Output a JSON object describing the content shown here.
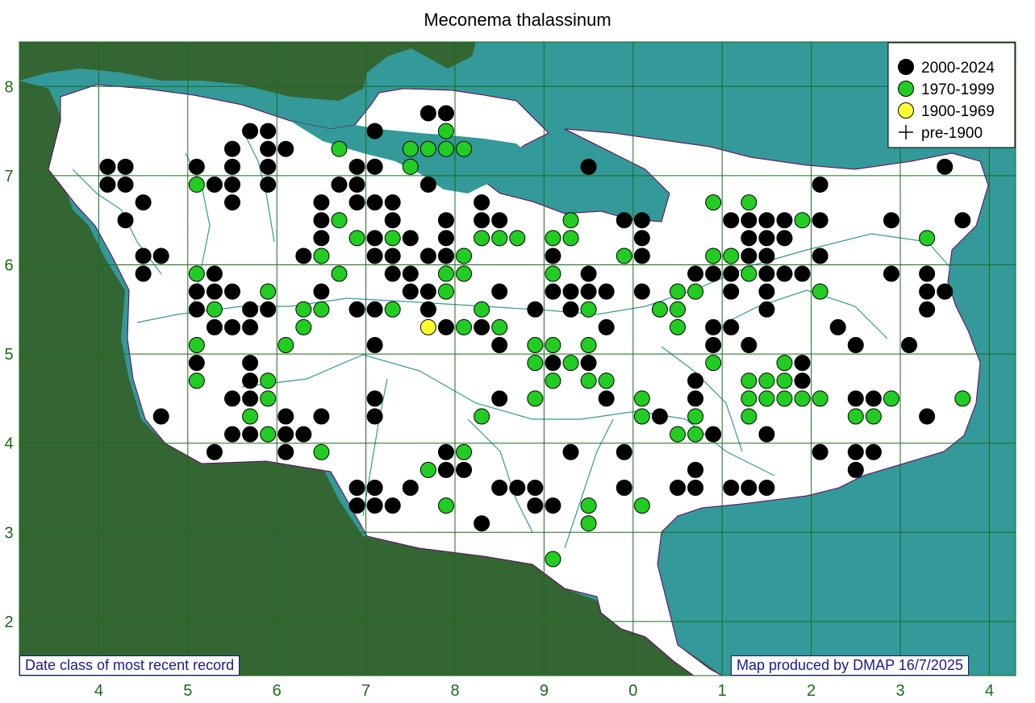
{
  "title": "Meconema thalassinum",
  "legend": [
    {
      "label": "2000-2024",
      "marker": "circle",
      "color": "#000000"
    },
    {
      "label": "1970-1999",
      "marker": "circle",
      "color": "#22cc22"
    },
    {
      "label": "1900-1969",
      "marker": "circle",
      "color": "#ffff33"
    },
    {
      "label": "pre-1900",
      "marker": "cross",
      "color": "#000000"
    }
  ],
  "x_axis_labels": [
    "4",
    "5",
    "6",
    "7",
    "8",
    "9",
    "0",
    "1",
    "2",
    "3",
    "4"
  ],
  "y_axis_labels": [
    "8",
    "7",
    "6",
    "5",
    "4",
    "3",
    "2"
  ],
  "notes": {
    "left": "Date class of most recent record",
    "right": "Map produced by DMAP 16/7/2025"
  },
  "colors": {
    "land_outside": "#336633",
    "sea": "#339999",
    "county": "#ffffff",
    "grid": "#1a6b1a",
    "river": "#339999",
    "boundary": "#660066"
  },
  "chart_data": {
    "type": "scatter",
    "title": "Meconema thalassinum",
    "series": [
      {
        "name": "2000-2024",
        "points": [
          [
            4.1,
            7.1
          ],
          [
            4.3,
            7.1
          ],
          [
            4.1,
            6.9
          ],
          [
            4.3,
            6.9
          ],
          [
            4.5,
            6.7
          ],
          [
            4.3,
            6.5
          ],
          [
            4.5,
            6.1
          ],
          [
            4.7,
            6.1
          ],
          [
            4.5,
            5.9
          ],
          [
            4.7,
            4.3
          ],
          [
            5.1,
            7.1
          ],
          [
            5.3,
            6.9
          ],
          [
            5.5,
            6.9
          ],
          [
            5.5,
            7.1
          ],
          [
            5.5,
            7.3
          ],
          [
            5.7,
            7.5
          ],
          [
            5.9,
            7.5
          ],
          [
            5.9,
            7.3
          ],
          [
            6.1,
            7.3
          ],
          [
            5.9,
            7.1
          ],
          [
            5.9,
            6.9
          ],
          [
            5.5,
            6.7
          ],
          [
            5.3,
            5.9
          ],
          [
            5.1,
            5.7
          ],
          [
            5.3,
            5.7
          ],
          [
            5.5,
            5.7
          ],
          [
            5.1,
            5.5
          ],
          [
            5.3,
            5.3
          ],
          [
            5.5,
            5.3
          ],
          [
            5.7,
            5.3
          ],
          [
            5.7,
            5.5
          ],
          [
            5.9,
            5.5
          ],
          [
            5.1,
            4.9
          ],
          [
            5.7,
            4.9
          ],
          [
            5.7,
            4.7
          ],
          [
            5.5,
            4.5
          ],
          [
            5.7,
            4.5
          ],
          [
            5.5,
            4.1
          ],
          [
            5.7,
            4.1
          ],
          [
            6.1,
            4.3
          ],
          [
            6.1,
            4.1
          ],
          [
            6.3,
            4.1
          ],
          [
            6.1,
            3.9
          ],
          [
            5.3,
            3.9
          ],
          [
            6.5,
            6.7
          ],
          [
            6.5,
            6.5
          ],
          [
            6.5,
            6.3
          ],
          [
            6.3,
            6.1
          ],
          [
            6.5,
            5.7
          ],
          [
            6.5,
            4.3
          ],
          [
            6.7,
            6.9
          ],
          [
            6.9,
            6.9
          ],
          [
            6.9,
            7.1
          ],
          [
            7.1,
            7.1
          ],
          [
            7.1,
            7.5
          ],
          [
            6.9,
            6.7
          ],
          [
            7.1,
            6.7
          ],
          [
            7.3,
            6.7
          ],
          [
            7.3,
            6.5
          ],
          [
            7.1,
            6.3
          ],
          [
            7.1,
            6.1
          ],
          [
            7.3,
            6.1
          ],
          [
            7.3,
            5.9
          ],
          [
            7.5,
            6.3
          ],
          [
            7.5,
            5.9
          ],
          [
            7.5,
            5.7
          ],
          [
            6.9,
            5.5
          ],
          [
            7.1,
            5.5
          ],
          [
            7.1,
            5.1
          ],
          [
            7.1,
            4.5
          ],
          [
            7.1,
            4.3
          ],
          [
            6.9,
            3.5
          ],
          [
            7.1,
            3.5
          ],
          [
            6.9,
            3.3
          ],
          [
            7.1,
            3.3
          ],
          [
            7.3,
            3.3
          ],
          [
            7.5,
            3.5
          ],
          [
            7.7,
            7.7
          ],
          [
            7.9,
            7.7
          ],
          [
            7.7,
            6.9
          ],
          [
            7.7,
            6.1
          ],
          [
            7.9,
            6.5
          ],
          [
            7.9,
            6.3
          ],
          [
            7.9,
            6.1
          ],
          [
            7.7,
            5.7
          ],
          [
            7.7,
            5.5
          ],
          [
            7.9,
            5.3
          ],
          [
            8.3,
            5.3
          ],
          [
            8.3,
            6.7
          ],
          [
            8.3,
            6.5
          ],
          [
            8.5,
            6.5
          ],
          [
            8.5,
            5.7
          ],
          [
            8.5,
            5.1
          ],
          [
            8.5,
            4.5
          ],
          [
            7.9,
            3.9
          ],
          [
            7.9,
            3.7
          ],
          [
            8.1,
            3.7
          ],
          [
            8.5,
            3.5
          ],
          [
            8.7,
            3.5
          ],
          [
            8.9,
            3.5
          ],
          [
            8.9,
            3.3
          ],
          [
            9.1,
            3.3
          ],
          [
            8.3,
            3.1
          ],
          [
            9.1,
            6.1
          ],
          [
            9.1,
            5.7
          ],
          [
            9.3,
            5.7
          ],
          [
            8.9,
            5.5
          ],
          [
            9.3,
            5.5
          ],
          [
            9.1,
            4.9
          ],
          [
            9.5,
            4.9
          ],
          [
            9.5,
            5.9
          ],
          [
            9.5,
            5.7
          ],
          [
            9.7,
            5.7
          ],
          [
            9.7,
            5.3
          ],
          [
            9.7,
            4.5
          ],
          [
            9.5,
            7.1
          ],
          [
            9.9,
            6.5
          ],
          [
            10.1,
            6.5
          ],
          [
            10.1,
            6.3
          ],
          [
            10.1,
            6.1
          ],
          [
            10.1,
            5.7
          ],
          [
            9.3,
            3.9
          ],
          [
            9.9,
            3.9
          ],
          [
            9.9,
            3.5
          ],
          [
            10.3,
            4.3
          ],
          [
            10.5,
            3.5
          ],
          [
            10.7,
            3.5
          ],
          [
            10.7,
            3.7
          ],
          [
            10.7,
            4.7
          ],
          [
            10.7,
            4.5
          ],
          [
            10.7,
            5.9
          ],
          [
            10.9,
            5.9
          ],
          [
            10.9,
            5.3
          ],
          [
            10.9,
            5.1
          ],
          [
            10.9,
            4.1
          ],
          [
            11.1,
            5.9
          ],
          [
            11.1,
            5.7
          ],
          [
            11.1,
            5.3
          ],
          [
            11.3,
            5.1
          ],
          [
            11.1,
            3.5
          ],
          [
            11.3,
            3.5
          ],
          [
            11.5,
            3.5
          ],
          [
            11.5,
            4.1
          ],
          [
            11.1,
            6.5
          ],
          [
            11.3,
            6.5
          ],
          [
            11.5,
            6.5
          ],
          [
            11.7,
            6.5
          ],
          [
            11.3,
            6.3
          ],
          [
            11.5,
            6.3
          ],
          [
            11.7,
            6.3
          ],
          [
            11.3,
            6.1
          ],
          [
            11.5,
            6.1
          ],
          [
            11.5,
            5.9
          ],
          [
            11.7,
            5.9
          ],
          [
            11.9,
            5.9
          ],
          [
            11.5,
            5.7
          ],
          [
            11.5,
            5.5
          ],
          [
            11.9,
            4.9
          ],
          [
            11.9,
            4.7
          ],
          [
            12.1,
            6.9
          ],
          [
            12.1,
            6.5
          ],
          [
            12.1,
            6.1
          ],
          [
            12.1,
            3.9
          ],
          [
            12.3,
            5.3
          ],
          [
            12.5,
            5.1
          ],
          [
            12.5,
            4.5
          ],
          [
            12.7,
            4.5
          ],
          [
            12.5,
            3.9
          ],
          [
            12.7,
            3.9
          ],
          [
            12.5,
            3.7
          ],
          [
            12.9,
            6.5
          ],
          [
            12.9,
            5.9
          ],
          [
            13.1,
            5.1
          ],
          [
            13.3,
            5.9
          ],
          [
            13.3,
            5.7
          ],
          [
            13.5,
            5.7
          ],
          [
            13.3,
            5.5
          ],
          [
            13.3,
            4.3
          ],
          [
            13.5,
            7.1
          ],
          [
            13.7,
            6.5
          ]
        ]
      },
      {
        "name": "1970-1999",
        "points": [
          [
            5.1,
            6.9
          ],
          [
            5.1,
            5.1
          ],
          [
            5.1,
            4.7
          ],
          [
            5.1,
            5.9
          ],
          [
            5.3,
            5.5
          ],
          [
            5.9,
            5.7
          ],
          [
            6.1,
            5.1
          ],
          [
            5.9,
            4.7
          ],
          [
            5.9,
            4.5
          ],
          [
            5.7,
            4.3
          ],
          [
            5.9,
            4.1
          ],
          [
            6.3,
            5.5
          ],
          [
            6.3,
            5.3
          ],
          [
            6.5,
            5.5
          ],
          [
            6.5,
            6.1
          ],
          [
            6.5,
            3.9
          ],
          [
            6.7,
            7.3
          ],
          [
            6.7,
            6.5
          ],
          [
            6.7,
            5.9
          ],
          [
            6.9,
            6.3
          ],
          [
            7.3,
            6.3
          ],
          [
            7.3,
            5.5
          ],
          [
            7.5,
            7.3
          ],
          [
            7.7,
            7.3
          ],
          [
            7.9,
            7.3
          ],
          [
            8.1,
            7.3
          ],
          [
            7.9,
            7.5
          ],
          [
            7.5,
            7.1
          ],
          [
            7.9,
            5.9
          ],
          [
            7.9,
            5.7
          ],
          [
            8.1,
            6.1
          ],
          [
            8.1,
            5.9
          ],
          [
            8.1,
            5.3
          ],
          [
            8.3,
            6.3
          ],
          [
            8.5,
            6.3
          ],
          [
            8.7,
            6.3
          ],
          [
            8.3,
            5.5
          ],
          [
            8.5,
            5.3
          ],
          [
            9.1,
            6.3
          ],
          [
            9.3,
            6.5
          ],
          [
            9.3,
            6.3
          ],
          [
            9.1,
            5.9
          ],
          [
            8.9,
            5.1
          ],
          [
            9.1,
            5.1
          ],
          [
            8.9,
            4.9
          ],
          [
            9.3,
            4.9
          ],
          [
            9.5,
            5.1
          ],
          [
            9.5,
            5.5
          ],
          [
            9.1,
            4.7
          ],
          [
            9.5,
            4.7
          ],
          [
            9.7,
            4.7
          ],
          [
            8.9,
            4.5
          ],
          [
            8.3,
            4.3
          ],
          [
            8.1,
            3.9
          ],
          [
            7.7,
            3.7
          ],
          [
            7.9,
            3.3
          ],
          [
            9.5,
            3.3
          ],
          [
            9.5,
            3.1
          ],
          [
            9.1,
            2.7
          ],
          [
            10.1,
            4.5
          ],
          [
            10.1,
            4.3
          ],
          [
            10.1,
            3.3
          ],
          [
            9.9,
            6.1
          ],
          [
            10.3,
            5.5
          ],
          [
            10.5,
            5.5
          ],
          [
            10.5,
            5.7
          ],
          [
            10.7,
            5.7
          ],
          [
            10.5,
            5.3
          ],
          [
            10.5,
            4.1
          ],
          [
            10.7,
            4.1
          ],
          [
            10.7,
            4.3
          ],
          [
            10.9,
            6.7
          ],
          [
            10.9,
            6.1
          ],
          [
            11.1,
            6.1
          ],
          [
            11.3,
            6.7
          ],
          [
            11.3,
            5.9
          ],
          [
            10.9,
            4.9
          ],
          [
            11.3,
            4.7
          ],
          [
            11.5,
            4.7
          ],
          [
            11.7,
            4.7
          ],
          [
            11.7,
            4.9
          ],
          [
            11.3,
            4.5
          ],
          [
            11.5,
            4.5
          ],
          [
            11.7,
            4.5
          ],
          [
            11.9,
            4.5
          ],
          [
            11.3,
            4.3
          ],
          [
            11.9,
            6.5
          ],
          [
            12.1,
            5.7
          ],
          [
            12.1,
            4.5
          ],
          [
            12.5,
            4.3
          ],
          [
            12.7,
            4.3
          ],
          [
            12.9,
            4.5
          ],
          [
            13.3,
            6.3
          ],
          [
            13.7,
            4.5
          ]
        ]
      },
      {
        "name": "1900-1969",
        "points": [
          [
            7.7,
            5.3
          ]
        ]
      },
      {
        "name": "pre-1900",
        "points": []
      }
    ],
    "xlim": [
      3.0,
      14.3
    ],
    "ylim": [
      1.6,
      8.5
    ],
    "grid": true,
    "legend_position": "top-right"
  }
}
